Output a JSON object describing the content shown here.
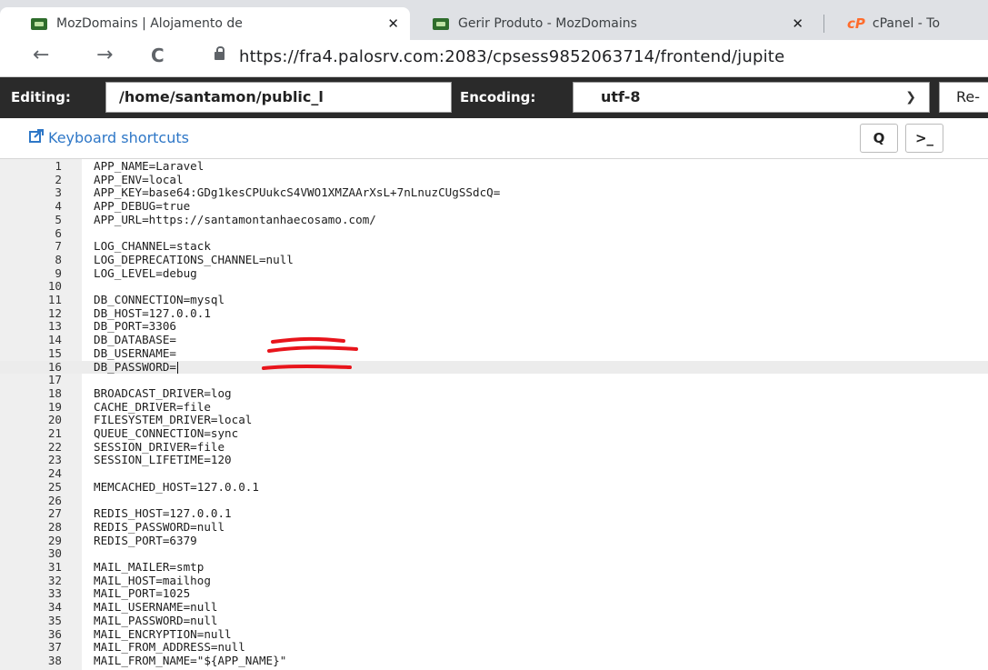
{
  "browser": {
    "tabs": [
      {
        "title": "MozDomains | Alojamento de",
        "close": "✕",
        "favicon": "mozdomains-icon"
      },
      {
        "title": "Gerir Produto - MozDomains",
        "close": "✕",
        "favicon": "mozdomains-icon"
      },
      {
        "title": "cPanel - To",
        "close": "",
        "favicon": "cpanel-icon"
      }
    ],
    "nav": {
      "back": "←",
      "forward": "→",
      "reload": "C"
    },
    "url": "https://fra4.palosrv.com:2083/cpsess9852063714/frontend/jupite"
  },
  "toolbar": {
    "editing_label": "Editing:",
    "path_value": "/home/santamon/public_l",
    "encoding_label": "Encoding:",
    "encoding_value": "utf-8",
    "reopen_label": "Re-"
  },
  "shortcuts": {
    "link_label": "Keyboard shortcuts",
    "search_glyph": "Q",
    "terminal_glyph": ">_"
  },
  "editor": {
    "active_line": 16,
    "lines": [
      {
        "n": "1",
        "text": "APP_NAME=Laravel"
      },
      {
        "n": "2",
        "text": "APP_ENV=local"
      },
      {
        "n": "3",
        "text": "APP_KEY=base64:GDg1kesCPUukcS4VWO1XMZAArXsL+7nLnuzCUgSSdcQ="
      },
      {
        "n": "4",
        "text": "APP_DEBUG=true"
      },
      {
        "n": "5",
        "text": "APP_URL=https://santamontanhaecosamo.com/"
      },
      {
        "n": "6",
        "text": ""
      },
      {
        "n": "7",
        "text": "LOG_CHANNEL=stack"
      },
      {
        "n": "8",
        "text": "LOG_DEPRECATIONS_CHANNEL=null"
      },
      {
        "n": "9",
        "text": "LOG_LEVEL=debug"
      },
      {
        "n": "10",
        "text": ""
      },
      {
        "n": "11",
        "text": "DB_CONNECTION=mysql"
      },
      {
        "n": "12",
        "text": "DB_HOST=127.0.0.1"
      },
      {
        "n": "13",
        "text": "DB_PORT=3306"
      },
      {
        "n": "14",
        "text": "DB_DATABASE="
      },
      {
        "n": "15",
        "text": "DB_USERNAME="
      },
      {
        "n": "16",
        "text": "DB_PASSWORD="
      },
      {
        "n": "17",
        "text": ""
      },
      {
        "n": "18",
        "text": "BROADCAST_DRIVER=log"
      },
      {
        "n": "19",
        "text": "CACHE_DRIVER=file"
      },
      {
        "n": "20",
        "text": "FILESYSTEM_DRIVER=local"
      },
      {
        "n": "21",
        "text": "QUEUE_CONNECTION=sync"
      },
      {
        "n": "22",
        "text": "SESSION_DRIVER=file"
      },
      {
        "n": "23",
        "text": "SESSION_LIFETIME=120"
      },
      {
        "n": "24",
        "text": ""
      },
      {
        "n": "25",
        "text": "MEMCACHED_HOST=127.0.0.1"
      },
      {
        "n": "26",
        "text": ""
      },
      {
        "n": "27",
        "text": "REDIS_HOST=127.0.0.1"
      },
      {
        "n": "28",
        "text": "REDIS_PASSWORD=null"
      },
      {
        "n": "29",
        "text": "REDIS_PORT=6379"
      },
      {
        "n": "30",
        "text": ""
      },
      {
        "n": "31",
        "text": "MAIL_MAILER=smtp"
      },
      {
        "n": "32",
        "text": "MAIL_HOST=mailhog"
      },
      {
        "n": "33",
        "text": "MAIL_PORT=1025"
      },
      {
        "n": "34",
        "text": "MAIL_USERNAME=null"
      },
      {
        "n": "35",
        "text": "MAIL_PASSWORD=null"
      },
      {
        "n": "36",
        "text": "MAIL_ENCRYPTION=null"
      },
      {
        "n": "37",
        "text": "MAIL_FROM_ADDRESS=null"
      },
      {
        "n": "38",
        "text": "MAIL_FROM_NAME=\"${APP_NAME}\""
      }
    ]
  },
  "colors": {
    "toolbar_bg": "#2a2a2a",
    "link": "#2e77c7",
    "redaction": "#e8141b",
    "cpanel_brand": "#ff6c2c"
  }
}
